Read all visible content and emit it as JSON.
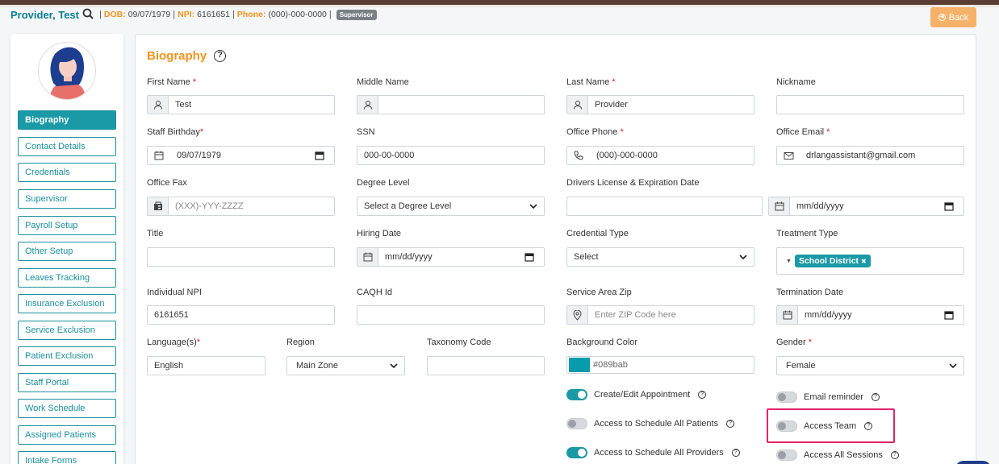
{
  "header": {
    "name": "Provider, Test",
    "dob_label": "DOB:",
    "dob_value": "09/07/1979",
    "npi_label": "NPI:",
    "npi_value": "6161651",
    "phone_label": "Phone:",
    "phone_value": "(000)-000-0000",
    "role_badge": "Supervisor",
    "sep": "|"
  },
  "back_button": {
    "label": "Back"
  },
  "sidebar": {
    "items": [
      {
        "label": "Biography",
        "active": true
      },
      {
        "label": "Contact Details"
      },
      {
        "label": "Credentials"
      },
      {
        "label": "Supervisor"
      },
      {
        "label": "Payroll Setup"
      },
      {
        "label": "Other Setup"
      },
      {
        "label": "Leaves Tracking"
      },
      {
        "label": "Insurance Exclusion"
      },
      {
        "label": "Service Exclusion"
      },
      {
        "label": "Patient Exclusion"
      },
      {
        "label": "Staff Portal"
      },
      {
        "label": "Work Schedule"
      },
      {
        "label": "Assigned Patients"
      },
      {
        "label": "Intake Forms"
      }
    ]
  },
  "panel": {
    "title": "Biography",
    "help": "?",
    "required_mark": "*",
    "fields": {
      "first_name": {
        "label": "First Name",
        "value": "Test"
      },
      "middle_name": {
        "label": "Middle Name",
        "value": ""
      },
      "last_name": {
        "label": "Last Name",
        "value": "Provider"
      },
      "nickname": {
        "label": "Nickname",
        "value": ""
      },
      "staff_birthday": {
        "label": "Staff Birthday",
        "value": "09/07/1979"
      },
      "ssn": {
        "label": "SSN",
        "value": "000-00-0000"
      },
      "office_phone": {
        "label": "Office Phone",
        "value": "(000)-000-0000"
      },
      "office_email": {
        "label": "Office Email",
        "value": "drlangassistant@gmail.com"
      },
      "office_fax": {
        "label": "Office Fax",
        "placeholder": "(XXX)-YYY-ZZZZ"
      },
      "degree_level": {
        "label": "Degree Level",
        "value": "Select a Degree Level"
      },
      "drivers_license": {
        "label": "Drivers License & Expiration Date",
        "value": "",
        "date_placeholder": "mm/dd/yyyy"
      },
      "title": {
        "label": "Title",
        "value": ""
      },
      "hiring_date": {
        "label": "Hiring Date",
        "placeholder": "mm/dd/yyyy"
      },
      "credential_type": {
        "label": "Credential Type",
        "value": "Select"
      },
      "treatment_type": {
        "label": "Treatment Type",
        "chip": "School District",
        "chip_remove": "✖"
      },
      "individual_npi": {
        "label": "Individual NPI",
        "value": "6161651"
      },
      "caqh_id": {
        "label": "CAQH Id",
        "value": ""
      },
      "service_area_zip": {
        "label": "Service Area Zip",
        "placeholder": "Enter ZIP Code here"
      },
      "termination_date": {
        "label": "Termination Date",
        "placeholder": "mm/dd/yyyy"
      },
      "languages": {
        "label": "Language(s)",
        "value": "English"
      },
      "region": {
        "label": "Region",
        "value": "Main Zone"
      },
      "taxonomy_code": {
        "label": "Taxonomy Code",
        "value": ""
      },
      "background_color": {
        "label": "Background Color",
        "value": "#089bab",
        "swatch": "#089bab"
      },
      "gender": {
        "label": "Gender",
        "value": "Female"
      }
    },
    "toggles": [
      {
        "label": "Create/Edit Appointment",
        "on": true
      },
      {
        "label": "Access to Schedule All Patients",
        "on": false
      },
      {
        "label": "Access to Schedule All Providers",
        "on": true
      },
      {
        "label": "Email reminder",
        "on": false
      },
      {
        "label": "Access Team",
        "on": false
      },
      {
        "label": "Access All Sessions",
        "on": false
      }
    ]
  },
  "colors": {
    "accent": "#1a9aa6",
    "orange": "#f0941e",
    "highlight": "#e3256b",
    "back": "#f6b26b"
  }
}
